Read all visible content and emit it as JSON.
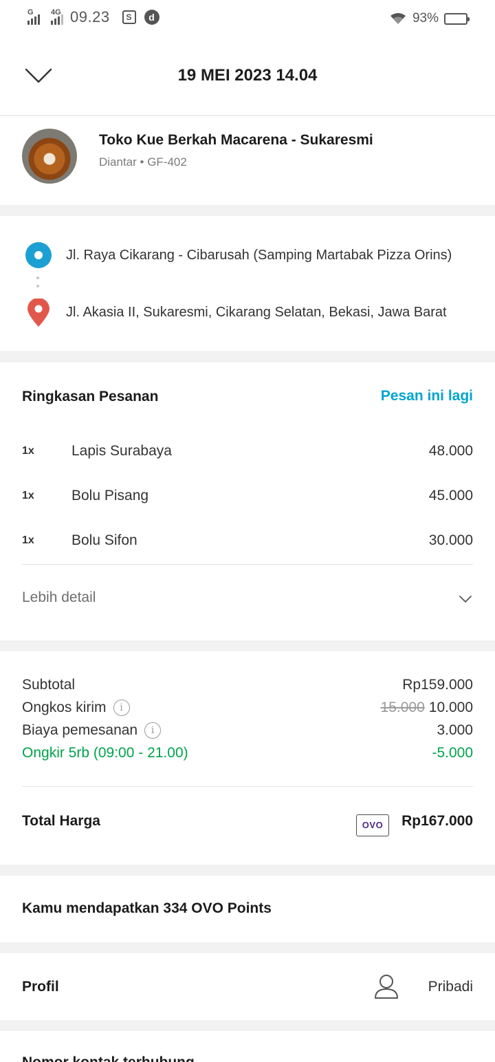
{
  "status_bar": {
    "sim1_label": "G",
    "sim2_label": "4G",
    "time": "09.23",
    "notif_icon_1": "S",
    "notif_icon_2": "d",
    "battery": "93%"
  },
  "header": {
    "title": "19 MEI 2023 14.04"
  },
  "merchant": {
    "name": "Toko Kue Berkah Macarena - Sukaresmi",
    "subtitle": "Diantar • GF-402"
  },
  "route": {
    "origin": "Jl. Raya Cikarang - Cibarusah (Samping Martabak Pizza Orins)",
    "destination": "Jl. Akasia II, Sukaresmi, Cikarang Selatan, Bekasi, Jawa Barat"
  },
  "summary": {
    "title": "Ringkasan Pesanan",
    "reorder_label": "Pesan ini lagi",
    "items": [
      {
        "qty": "1x",
        "name": "Lapis Surabaya",
        "price": "48.000"
      },
      {
        "qty": "1x",
        "name": "Bolu Pisang",
        "price": "45.000"
      },
      {
        "qty": "1x",
        "name": "Bolu Sifon",
        "price": "30.000"
      }
    ],
    "more_label": "Lebih detail"
  },
  "costs": {
    "subtotal_label": "Subtotal",
    "subtotal_value": "Rp159.000",
    "delivery_label": "Ongkos kirim",
    "delivery_original": "15.000",
    "delivery_value": "10.000",
    "order_fee_label": "Biaya pemesanan",
    "order_fee_value": "3.000",
    "promo_label": "Ongkir 5rb (09:00 - 21.00)",
    "promo_value": "-5.000",
    "total_label": "Total Harga",
    "payment_method": "OVO",
    "total_value": "Rp167.000"
  },
  "points": {
    "text": "Kamu mendapatkan 334 OVO Points"
  },
  "profile": {
    "label": "Profil",
    "value": "Pribadi"
  },
  "next_section": {
    "title": "Nomor kontak terhubung"
  },
  "colors": {
    "accent": "#00a5cf",
    "promo_green": "#00a44a",
    "origin_pin": "#1ca0d3",
    "dest_pin": "#e2574c"
  }
}
